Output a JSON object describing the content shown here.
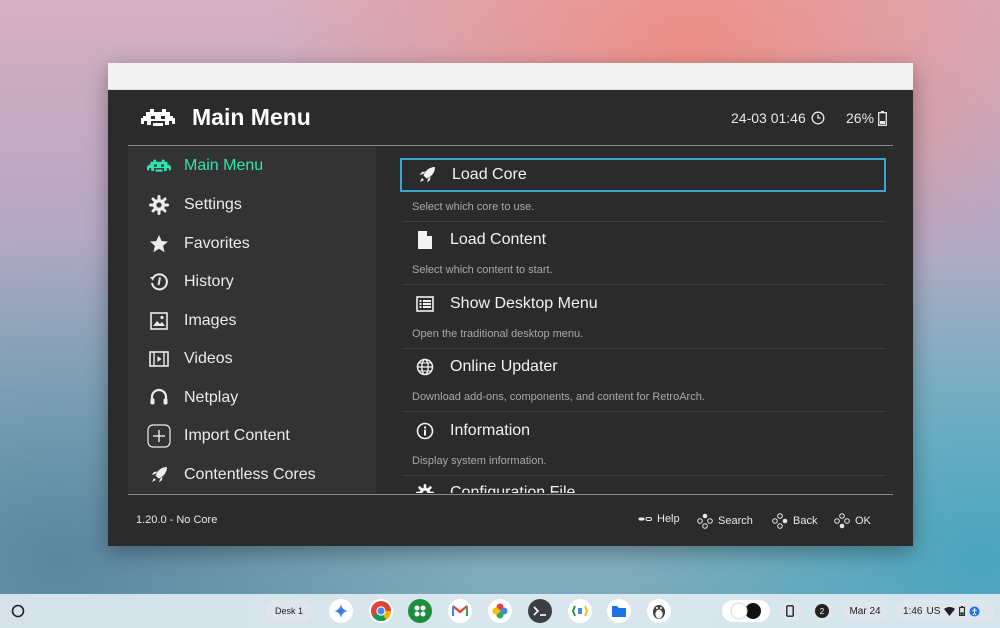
{
  "header": {
    "title": "Main Menu",
    "datetime": "24-03 01:46",
    "battery": "26%"
  },
  "sidebar": {
    "items": [
      {
        "label": "Main Menu",
        "icon": "invader-icon",
        "active": true
      },
      {
        "label": "Settings",
        "icon": "gear-icon"
      },
      {
        "label": "Favorites",
        "icon": "star-icon"
      },
      {
        "label": "History",
        "icon": "history-icon"
      },
      {
        "label": "Images",
        "icon": "image-icon"
      },
      {
        "label": "Videos",
        "icon": "film-icon"
      },
      {
        "label": "Netplay",
        "icon": "headset-icon"
      },
      {
        "label": "Import Content",
        "icon": "plus-box-icon"
      },
      {
        "label": "Contentless Cores",
        "icon": "rocket-icon"
      }
    ]
  },
  "menu": {
    "entries": [
      {
        "label": "Load Core",
        "sublabel": "Select which core to use.",
        "icon": "rocket-icon"
      },
      {
        "label": "Load Content",
        "sublabel": "Select which content to start.",
        "icon": "file-icon"
      },
      {
        "label": "Show Desktop Menu",
        "sublabel": "Open the traditional desktop menu.",
        "icon": "desktop-menu-icon"
      },
      {
        "label": "Online Updater",
        "sublabel": "Download add-ons, components, and content for RetroArch.",
        "icon": "globe-icon"
      },
      {
        "label": "Information",
        "sublabel": "Display system information.",
        "icon": "info-icon"
      },
      {
        "label": "Configuration File",
        "icon": "gear-icon"
      }
    ]
  },
  "footer": {
    "version": "1.20.0 - No Core",
    "hints": {
      "help": "Help",
      "search": "Search",
      "back": "Back",
      "ok": "OK"
    }
  },
  "shelf": {
    "desk": "Desk 1",
    "notifications": "2",
    "date": "Mar 24",
    "time": "1:46",
    "locale": "US"
  },
  "colors": {
    "accent": "#2ee6b0",
    "selection": "#3ba5d8",
    "background": "#2b2b2b",
    "sidebar": "#333333"
  }
}
